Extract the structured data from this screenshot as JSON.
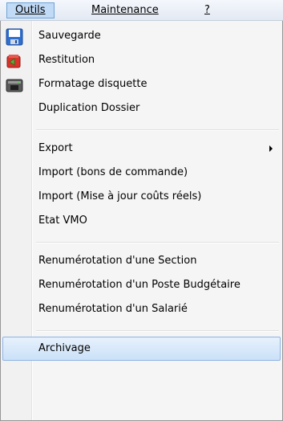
{
  "menubar": {
    "items": [
      {
        "label": "Outils"
      },
      {
        "label": "Maintenance"
      },
      {
        "label": "?"
      }
    ]
  },
  "menu": {
    "items": [
      {
        "label": "Sauvegarde",
        "icon": "floppy-save-icon"
      },
      {
        "label": "Restitution",
        "icon": "restore-icon"
      },
      {
        "label": "Formatage disquette",
        "icon": "floppy-drive-icon"
      },
      {
        "label": "Duplication Dossier"
      },
      {
        "label": "Export"
      },
      {
        "label": "Import (bons de commande)"
      },
      {
        "label": "Import (Mise à jour coûts réels)"
      },
      {
        "label": "Etat VMO"
      },
      {
        "label": "Renumérotation d'une Section"
      },
      {
        "label": "Renumérotation d'un Poste Budgétaire"
      },
      {
        "label": "Renumérotation d'un Salarié"
      },
      {
        "label": "Archivage"
      }
    ]
  },
  "colors": {
    "highlight": "#cbe1f8",
    "highlight_border": "#8db2e3",
    "menu_bg": "#f5f5f5"
  }
}
